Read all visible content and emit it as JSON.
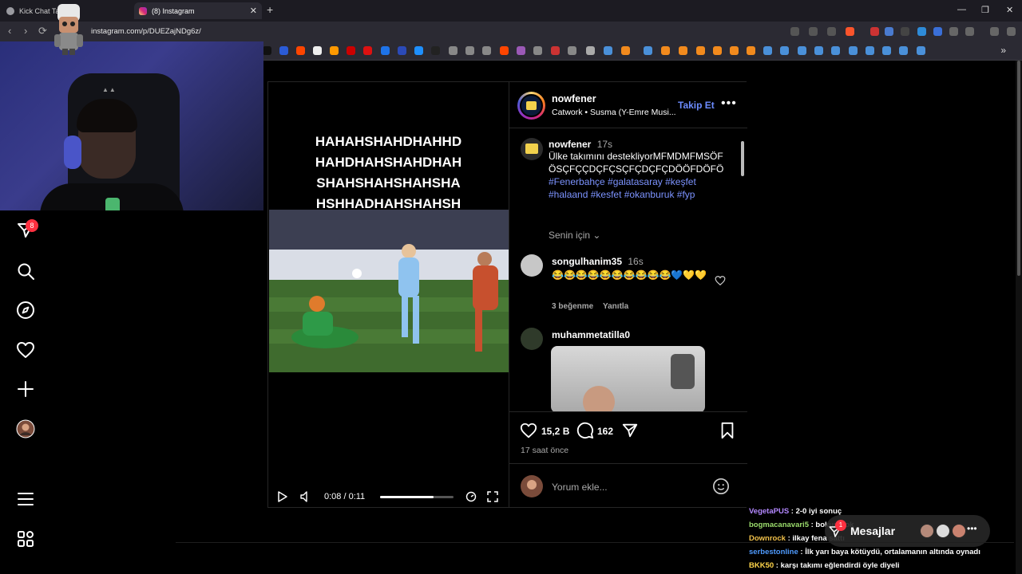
{
  "browser": {
    "tabs": [
      {
        "label": "Kick Chat Takip",
        "active": false
      },
      {
        "label": "(8) Instagram",
        "active": true
      }
    ],
    "url": "instagram.com/p/DUEZajNDg6z/",
    "window_controls": [
      "—",
      "❐",
      "✕"
    ]
  },
  "sidebar": {
    "notification_count": "8",
    "items": [
      "messages-icon",
      "search-icon",
      "explore-icon",
      "notifications-icon",
      "create-icon",
      "profile-icon",
      "menu-icon",
      "more-icon"
    ]
  },
  "post": {
    "video": {
      "caption_lines": [
        "HAHAHSHAHDHAHHD",
        "HAHDHAHSHAHDHAH",
        "SHAHSHAHSHAHSHA",
        "HSHHADHAHSHAHSH"
      ],
      "time": "0:08 / 0:11",
      "progress": 0.73
    },
    "header": {
      "username": "nowfener",
      "audio": "Catwork • Susma (Y-Emre Musi...",
      "follow_label": "Takip Et"
    },
    "caption": {
      "username": "nowfener",
      "time": "17s",
      "text": "Ülke takımını destekliyorMFMDMFMSÖFÖSÇFÇÇDÇFÇSÇFÇDÇFÇDÖÖFDÖFÖ",
      "tags_line1": "#Fenerbahçe #galatasaray #keşfet",
      "tags_line2": "#halaand #kesfet #okanburuk #fyp",
      "sort_label": "Senin için ⌄"
    },
    "comments": [
      {
        "username": "songulhanim35",
        "time": "16s",
        "emoji": "😂😂😂😂😂😂😂😂😂😂💙💛💛",
        "likes": "3 beğenme",
        "reply": "Yanıtla"
      },
      {
        "username": "muhammetatilla0"
      }
    ],
    "actions": {
      "likes": "15,2 B",
      "comments": "162",
      "posted": "17 saat önce",
      "comment_placeholder": "Yorum ekle..."
    }
  },
  "chat": [
    {
      "user": "VegetaPUS",
      "color": "#b388ff",
      "text": " : 2-0 iyi sonuç"
    },
    {
      "user": "bogmacanavari5",
      "color": "#9bdc6c",
      "text": " : bokumbok"
    },
    {
      "user": "Downrock",
      "color": "#f0c04a",
      "text": " : ilkay fena sattı"
    },
    {
      "user": "serbestonline",
      "color": "#4f9bff",
      "text": " : İlk yarı baya kötüydü, ortalamanın altında oynadı"
    },
    {
      "user": "BKK50",
      "color": "#ffd54a",
      "text": " : karşı takımı eğlendirdi öyle diyeli"
    }
  ],
  "messages_bar": {
    "label": "Mesajlar",
    "unread": "1"
  }
}
